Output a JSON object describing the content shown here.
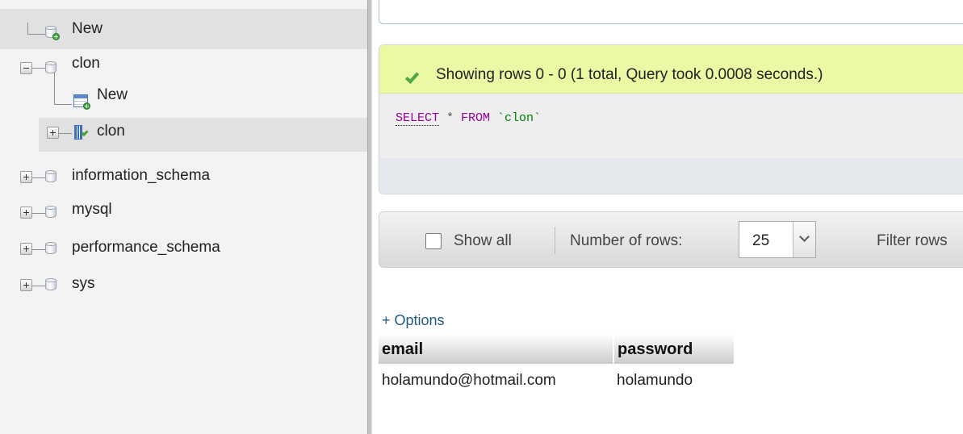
{
  "navigation": {
    "items": [
      {
        "label": "New",
        "type": "new-database"
      },
      {
        "label": "clon",
        "type": "database",
        "expanded": true
      },
      {
        "label": "New",
        "type": "new-table"
      },
      {
        "label": "clon",
        "type": "view"
      },
      {
        "label": "information_schema",
        "type": "database"
      },
      {
        "label": "mysql",
        "type": "database"
      },
      {
        "label": "performance_schema",
        "type": "database"
      },
      {
        "label": "sys",
        "type": "database"
      }
    ]
  },
  "main": {
    "success_message": "Showing rows 0 - 0 (1 total, Query took 0.0008 seconds.)",
    "sql": {
      "select": "SELECT",
      "star": " * ",
      "from": "FROM",
      "table": " `clon`"
    },
    "toolbar": {
      "show_all_label": "Show all",
      "show_all_checked": false,
      "rows_label": "Number of rows:",
      "rows_value": "25",
      "filter_label": "Filter rows"
    },
    "options_link": "+ Options",
    "table": {
      "columns": [
        "email",
        "password"
      ],
      "rows": [
        [
          "holamundo@hotmail.com",
          "holamundo"
        ]
      ]
    }
  },
  "colors": {
    "success_bg": "#ebf8a4",
    "sql_keyword": "#990099",
    "link": "#235a81"
  }
}
